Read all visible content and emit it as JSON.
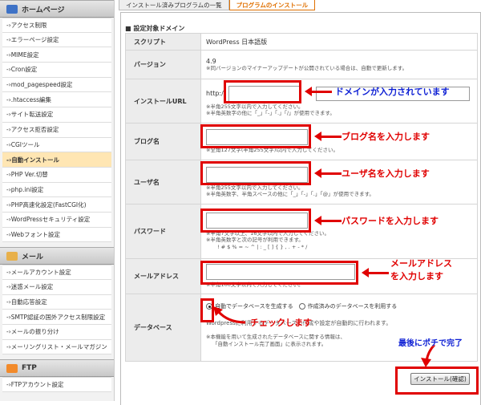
{
  "sidebar": {
    "categories": [
      {
        "label": "ホームページ",
        "icon": "house-icon"
      },
      {
        "label": "メール",
        "icon": "mail-icon"
      },
      {
        "label": "FTP",
        "icon": "folder-icon"
      }
    ],
    "home_items": [
      "-›アクセス制限",
      "-›エラーページ設定",
      "-›MIME設定",
      "-›Cron設定",
      "-›mod_pagespeed設定",
      "-›.htaccess編集",
      "-›サイト転送設定",
      "-›アクセス拒否設定",
      "-›CGIツール",
      "-›自動インストール",
      "-›PHP Ver.切替",
      "-›php.ini設定",
      "-›PHP高速化設定(FastCGI化)",
      "-›WordPressセキュリティ設定",
      "-›Webフォント設定"
    ],
    "mail_items": [
      "-›メールアカウント設定",
      "-›迷惑メール設定",
      "-›自動応答設定",
      "-›SMTP認証の国外アクセス制限設定",
      "-›メールの振り分け",
      "-›メーリングリスト・メールマガジン"
    ],
    "ftp_items": [
      "-›FTPアカウント設定"
    ]
  },
  "tabs": [
    {
      "label": "インストール済みプログラムの一覧"
    },
    {
      "label": "プログラムのインストール"
    }
  ],
  "section_title": "■ 設定対象ドメイン",
  "form": {
    "script_label": "スクリプト",
    "script_value": "WordPress 日本語版",
    "version_label": "バージョン",
    "version_value": "4.9",
    "version_note": "※同バージョンのマイナーアップデートが公開されている場合は、自動で更新します。",
    "url_label": "インストールURL",
    "url_prefix": "http://",
    "url_note1": "※半角255文字以内で入力してください。",
    "url_note2": "※半角英数字の他に「_」「-」「.」「/」が使用できます。",
    "blog_label": "ブログ名",
    "blog_note": "※全角127文字(半角255文字)以内で入力してください。",
    "user_label": "ユーザ名",
    "user_note1": "※半角255文字以内で入力してください。",
    "user_note2": "※半角英数字、半角スペースの他に「_」「-」「.」「@」が使用できます。",
    "pw_label": "パスワード",
    "pw_note1": "※半角7文字以上、16文字以内で入力してください。",
    "pw_note2": "※半角英数字と次の記号が利用できます。",
    "pw_symbols": "! # $ % = ~ ^ | : _ [ ] { } , . + - * /",
    "mail_label": "メールアドレス",
    "mail_note": "※半角100文字以内で入力してください。",
    "db_label": "データベース",
    "db_opt1": "自動でデータベースを生成する",
    "db_opt2": "作成済みのデータベースを利用する",
    "db_note1": "Wordpressに利用するデータベースの作成や設定が自動的に行われます。",
    "db_note2": "※本機能を用いて生成されたデータベースに関する情報は、",
    "db_note3": "「自動インストール完了画面」に表示されます。"
  },
  "annotations": {
    "domain": "ドメインが入力されています",
    "blog": "ブログ名を入力します",
    "user": "ユーザ名を入力します",
    "password": "パスワードを入力します",
    "mail_line1": "メールアドレス",
    "mail_line2": "を入力します",
    "check": "チェックします",
    "finish": "最後にポチで完了"
  },
  "install_button": "インストール(確認)",
  "colors": {
    "annotation_red": "#e00000",
    "annotation_blue": "#0d1fd4",
    "active_tab": "#e07000"
  }
}
